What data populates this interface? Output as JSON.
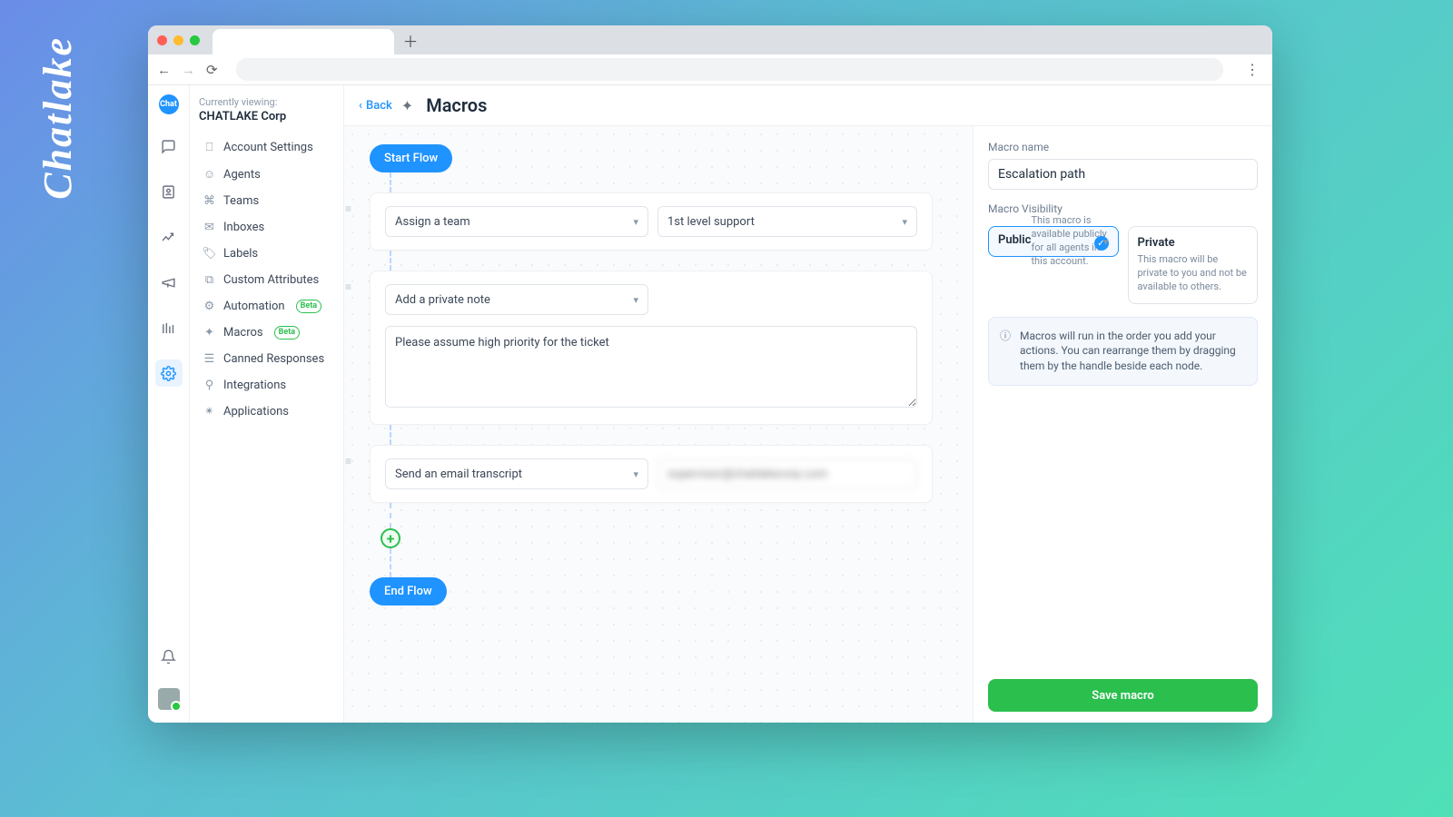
{
  "brand": "Chatlake",
  "sidebar": {
    "viewing_label": "Currently viewing:",
    "corp": "CHATLAKE Corp",
    "items": [
      {
        "label": "Account Settings"
      },
      {
        "label": "Agents"
      },
      {
        "label": "Teams"
      },
      {
        "label": "Inboxes"
      },
      {
        "label": "Labels"
      },
      {
        "label": "Custom Attributes"
      },
      {
        "label": "Automation",
        "badge": "Beta"
      },
      {
        "label": "Macros",
        "badge": "Beta"
      },
      {
        "label": "Canned Responses"
      },
      {
        "label": "Integrations"
      },
      {
        "label": "Applications"
      }
    ]
  },
  "header": {
    "back": "Back",
    "title": "Macros"
  },
  "flow": {
    "start": "Start Flow",
    "end": "End Flow",
    "nodes": [
      {
        "action": "Assign a team",
        "value": "1st level support"
      },
      {
        "action": "Add a private note",
        "note": "Please assume high priority for the ticket"
      },
      {
        "action": "Send an email transcript",
        "email": "supervisor@chatlakecorp.com"
      }
    ]
  },
  "rpanel": {
    "name_label": "Macro name",
    "name_value": "Escalation path",
    "vis_label": "Macro Visibility",
    "public": {
      "title": "Public",
      "desc": "This macro is available publicly for all agents in this account."
    },
    "private": {
      "title": "Private",
      "desc": "This macro will be private to you and not be available to others."
    },
    "info": "Macros will run in the order you add your actions. You can rearrange them by dragging them by the handle beside each node.",
    "save": "Save macro"
  }
}
